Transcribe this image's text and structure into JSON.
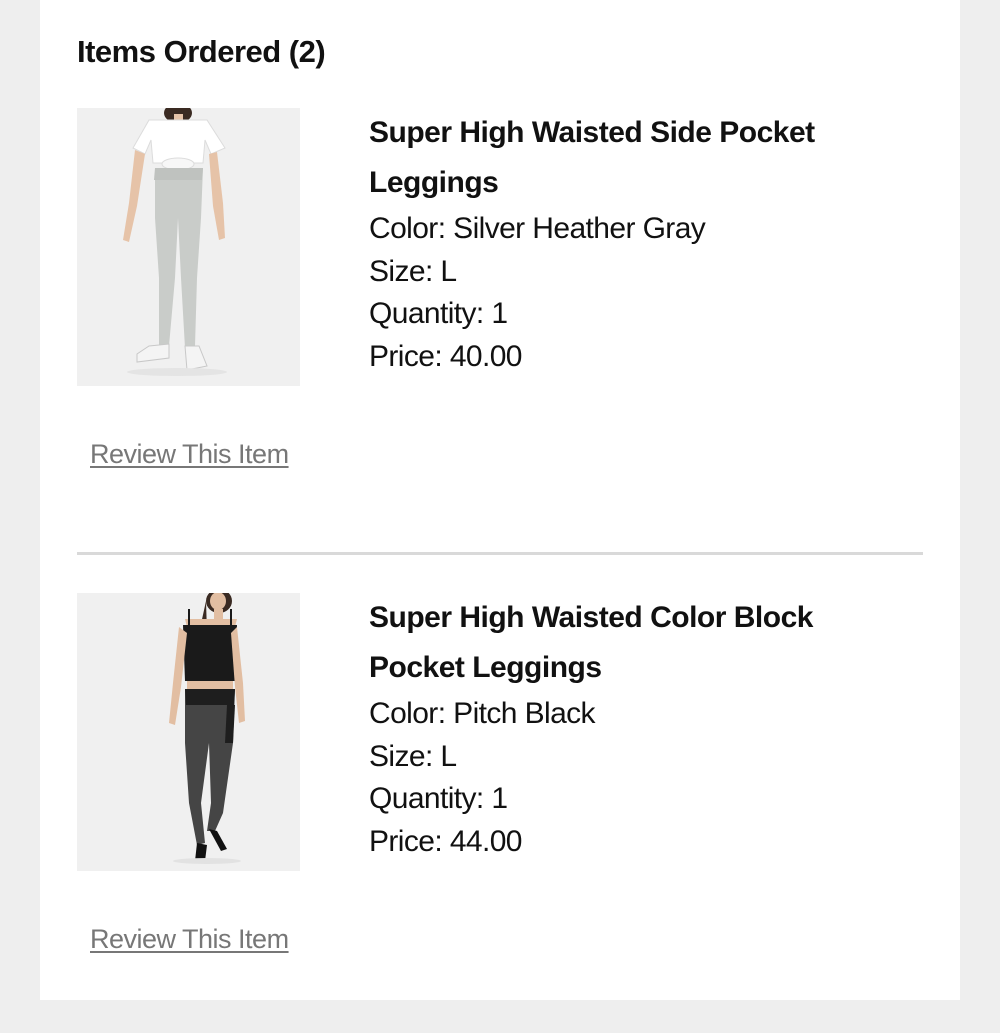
{
  "order": {
    "section_title": "Items Ordered (2)",
    "items": [
      {
        "image_icon": "product-photo-gray-leggings",
        "name": "Super High Waisted Side Pocket Leggings",
        "color_line": "Color: Silver Heather Gray",
        "size_line": "Size: L",
        "quantity_line": "Quantity: 1",
        "price_line": "Price: 40.00",
        "review_label": "Review This Item"
      },
      {
        "image_icon": "product-photo-black-leggings",
        "name": "Super High Waisted Color Block Pocket Leggings",
        "color_line": "Color: Pitch Black",
        "size_line": "Size: L",
        "quantity_line": "Quantity: 1",
        "price_line": "Price: 44.00",
        "review_label": "Review This Item"
      }
    ]
  },
  "colors": {
    "background": "#eeeeee",
    "panel": "#ffffff",
    "text": "#111111",
    "link": "#777777",
    "divider": "#d9d9d9"
  }
}
